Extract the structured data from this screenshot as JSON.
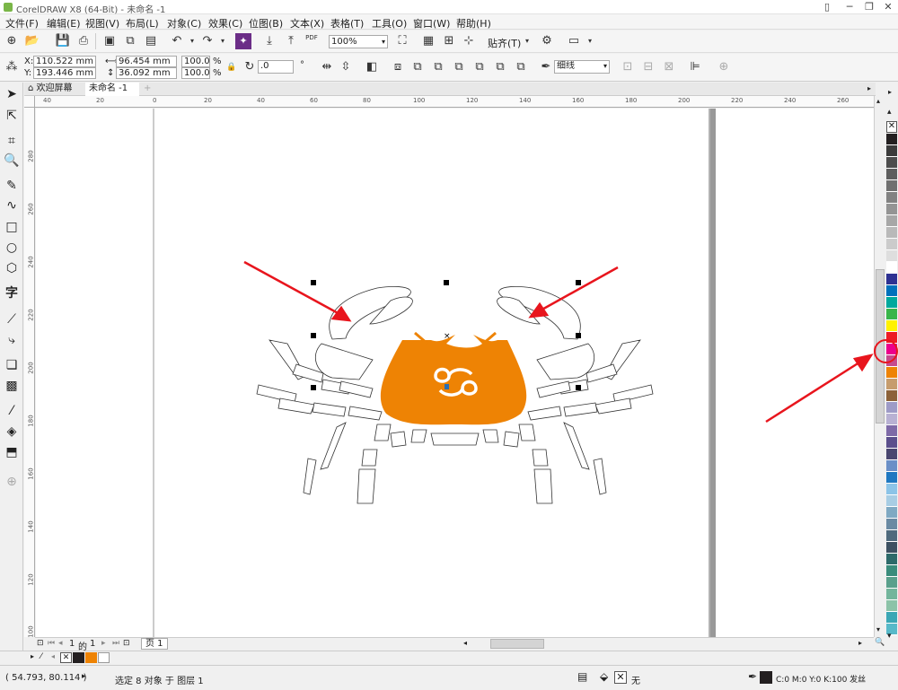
{
  "window": {
    "title": "CorelDRAW X8 (64-Bit) - 未命名 -1"
  },
  "menu": [
    "文件(F)",
    "编辑(E)",
    "视图(V)",
    "布局(L)",
    "对象(C)",
    "效果(C)",
    "位图(B)",
    "文本(X)",
    "表格(T)",
    "工具(O)",
    "窗口(W)",
    "帮助(H)"
  ],
  "toolbar": {
    "zoom": "100%",
    "snap_label": "贴齐(T)",
    "pdf_label": "PDF"
  },
  "props": {
    "x": "110.522 mm",
    "y": "193.446 mm",
    "w": "96.454 mm",
    "h": "36.092 mm",
    "scale_w": "100.0",
    "scale_h": "100.0",
    "pct": "%",
    "angle": ".0",
    "outline": "细线",
    "x_label": "X:",
    "y_label": "Y:"
  },
  "tabs": {
    "home": "欢迎屏幕",
    "doc": "未命名 -1"
  },
  "rulers": {
    "h": [
      "40",
      "20",
      "0",
      "20",
      "40",
      "60",
      "80",
      "100",
      "120",
      "140",
      "160",
      "180",
      "200",
      "220",
      "240",
      "260"
    ],
    "v": [
      "280",
      "260",
      "240",
      "220",
      "200",
      "180",
      "160",
      "140",
      "120",
      "100"
    ]
  },
  "pagenav": {
    "current": "1",
    "of": "的",
    "total": "1",
    "page_tab": "页 1"
  },
  "status": {
    "coords": "( 54.793, 80.114 )",
    "selection": "选定 8 对象 于 图层 1",
    "fill_none": "无",
    "outline_desc": "C:0 M:0 Y:0 K:100  发丝"
  },
  "colors": {
    "accent_orange": "#ee8304",
    "arrow_red": "#e8151d"
  },
  "palette": [
    "#231f20",
    "#3b3b3b",
    "#4d4d4d",
    "#5e5e5e",
    "#707070",
    "#828282",
    "#949494",
    "#a7a7a7",
    "#b9b9b9",
    "#cbcbcb",
    "#dedede",
    "#ffffff",
    "#2e3192",
    "#0071bc",
    "#00a99d",
    "#39b54a",
    "#fff200",
    "#ed1c24",
    "#ec008c",
    "#c64a8e",
    "#ee8304",
    "#c69c6d",
    "#8c6239",
    "#9e9bc7",
    "#b8b1d3",
    "#7e6aa7",
    "#5b4f8c",
    "#4a4770",
    "#6a8fc7",
    "#1f78c1",
    "#8cc4e8",
    "#a8cde4",
    "#7fa9c3",
    "#6a8aa3",
    "#4f6a7d",
    "#3d5162",
    "#2d6a6a",
    "#3a8c7c",
    "#5aa08c",
    "#73b59c",
    "#8cc3a8",
    "#3ba7b5",
    "#57b9c9"
  ]
}
